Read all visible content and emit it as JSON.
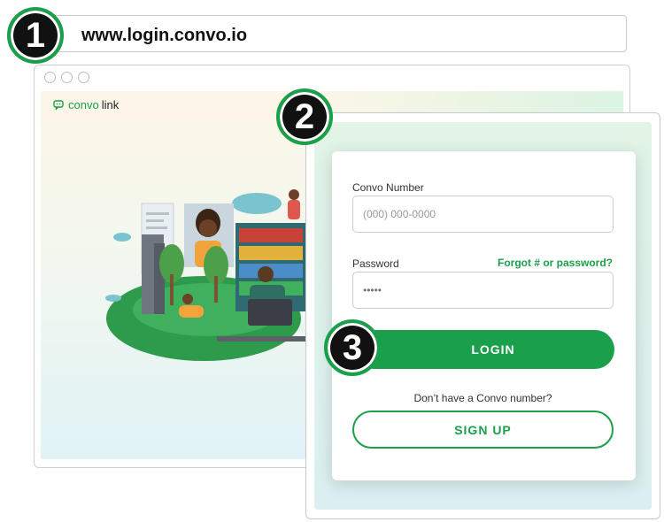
{
  "steps": [
    "1",
    "2",
    "3"
  ],
  "url": "www.login.convo.io",
  "logo": {
    "part1": "convo",
    "part2": "link"
  },
  "form": {
    "number_label": "Convo Number",
    "number_placeholder": "(000) 000-0000",
    "password_label": "Password",
    "forgot_link": "Forgot # or password?",
    "password_value": "•••••",
    "login_button": "LOGIN",
    "no_account_text": "Don’t have a Convo number?",
    "signup_button": "SIGN UP"
  },
  "colors": {
    "accent": "#1aa04a",
    "badge": "#111111"
  },
  "icons": [
    "browser-dot-icon",
    "convo-logo-icon"
  ]
}
